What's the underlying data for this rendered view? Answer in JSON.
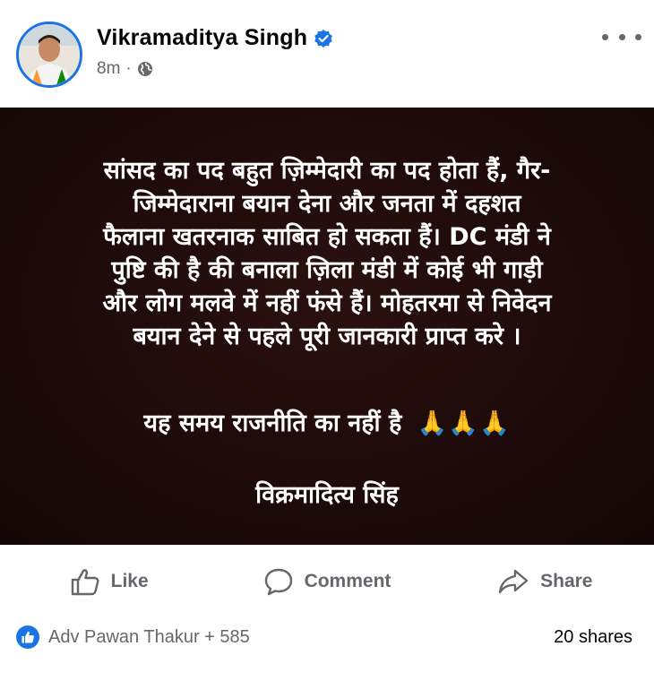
{
  "header": {
    "author_name": "Vikramaditya Singh",
    "time": "8m",
    "separator": "·",
    "audience_icon": "globe-icon",
    "verified_icon": "verified-badge-icon",
    "more_icon": "more-options-icon"
  },
  "post": {
    "lines": [
      "सांसद का पद बहुत ज़िम्मेदारी का पद होता हैं, गैर-",
      "जिम्मेदाराना बयान देना और जनता में दहशत",
      "फैलाना खतरनाक साबित हो सकता हैं। DC मंडी ने",
      "पुष्टि की है की बनाला ज़िला मंडी में कोई भी गाड़ी",
      "और लोग मलवे में नहीं फंसे हैं। मोहतरमा से निवेदन",
      "बयान देने से पहले पूरी जानकारी प्राप्त करे ।"
    ],
    "line2": "यह समय राजनीति का नहीं है",
    "pray_icons": "🙏🙏🙏",
    "signature": "विक्रमादित्य सिंह",
    "background_color": "#1f0c0b",
    "text_color": "#ffffff"
  },
  "actions": {
    "like_label": "Like",
    "comment_label": "Comment",
    "share_label": "Share"
  },
  "footer": {
    "reactors": "Adv Pawan Thakur + 585",
    "shares": "20 shares"
  },
  "colors": {
    "accent": "#1b74e4",
    "secondary_text": "#65676b"
  }
}
